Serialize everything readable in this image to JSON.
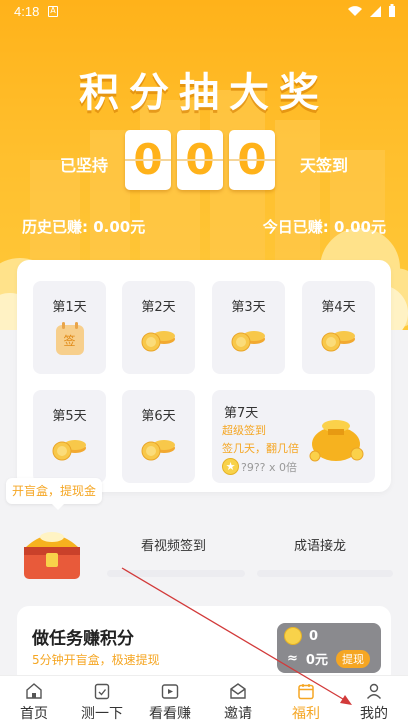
{
  "status_bar": {
    "time": "4:18",
    "notification_icon": "A"
  },
  "banner": {
    "title": "积分抽大奖",
    "persist_label": "已坚持",
    "digits": [
      "0",
      "0",
      "0"
    ],
    "days_label": "天签到",
    "history_earned": "历史已赚: 0.00元",
    "today_earned": "今日已赚: 0.00元"
  },
  "checkin": {
    "days": [
      {
        "label": "第1天",
        "icon": "签",
        "signed": true
      },
      {
        "label": "第2天",
        "icon": "coins-icon"
      },
      {
        "label": "第3天",
        "icon": "coins-icon"
      },
      {
        "label": "第4天",
        "icon": "coins-icon"
      },
      {
        "label": "第5天",
        "icon": "coins-icon"
      },
      {
        "label": "第6天",
        "icon": "coins-icon"
      }
    ],
    "day7": {
      "label": "第7天",
      "line1": "超级签到",
      "line2": "签几天，翻几倍",
      "line3": "?9?? x 0倍"
    }
  },
  "blindbox": {
    "tooltip": "开盲盒，提现金"
  },
  "tabs": {
    "video": "看视频签到",
    "idiom": "成语接龙"
  },
  "task": {
    "title": "做任务赚积分",
    "subtitle": "5分钟开盲盒，极速提现",
    "coins": "0",
    "approx": "≈",
    "money": "0元",
    "withdraw": "提现"
  },
  "nav": {
    "items": [
      {
        "label": "首页",
        "icon": "home-icon"
      },
      {
        "label": "测一下",
        "icon": "clipboard-icon"
      },
      {
        "label": "看看赚",
        "icon": "play-icon"
      },
      {
        "label": "邀请",
        "icon": "envelope-icon"
      },
      {
        "label": "福利",
        "icon": "calendar-icon",
        "active": true
      },
      {
        "label": "我的",
        "icon": "user-icon"
      }
    ]
  },
  "colors": {
    "accent": "#f5a623",
    "banner": "#ffb21a"
  }
}
